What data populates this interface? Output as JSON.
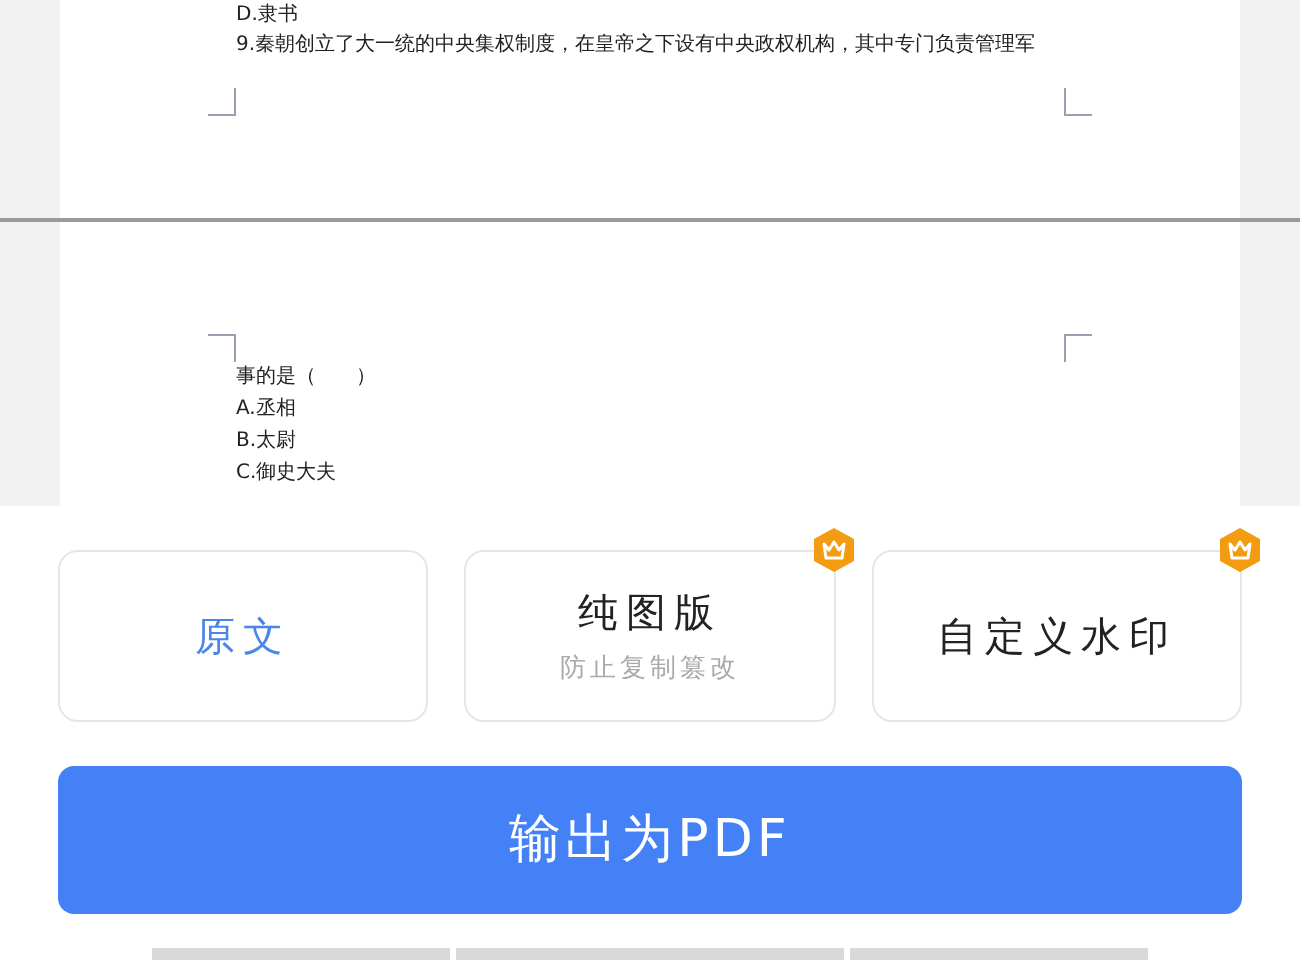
{
  "document": {
    "page_1_lines": [
      "D.隶书",
      "9.秦朝创立了大一统的中央集权制度，在皇帝之下设有中央政权机构，其中专门负责管理军"
    ],
    "page_2_lines": [
      "事的是（　　）",
      "A.丞相",
      "B.太尉",
      "C.御史大夫"
    ]
  },
  "options": [
    {
      "title": "原文",
      "selected": true,
      "premium": false
    },
    {
      "title": "纯图版",
      "subtitle": "防止复制篡改",
      "selected": false,
      "premium": true
    },
    {
      "title": "自定义水印",
      "selected": false,
      "premium": true
    }
  ],
  "export_button": "输出为PDF"
}
